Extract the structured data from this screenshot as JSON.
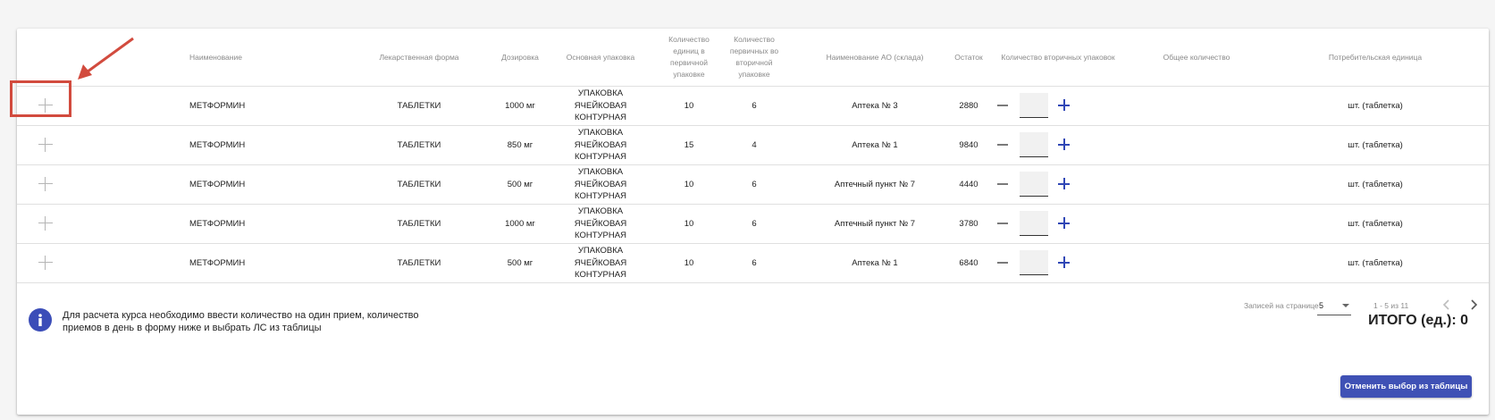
{
  "table": {
    "headers": {
      "name": "Наименование",
      "form": "Лекарственная форма",
      "dosage": "Дозировка",
      "main_pack": "Основная упаковка",
      "units_in_primary": [
        "Количество",
        "единиц в",
        "первичной",
        "упаковке"
      ],
      "primary_in_secondary": [
        "Количество",
        "первичных во",
        "вторичной",
        "упаковке"
      ],
      "warehouse": "Наименование АО (склада)",
      "stock": "Остаток",
      "secondary_qty": "Количество вторичных упаковок",
      "total_qty": "Общее количество",
      "consumer_unit": "Потребительская единица"
    },
    "rows": [
      {
        "name": "МЕТФОРМИН",
        "form": "ТАБЛЕТКИ",
        "dosage": "1000 мг",
        "pack": [
          "УПАКОВКА",
          "ЯЧЕЙКОВАЯ",
          "КОНТУРНАЯ"
        ],
        "units": "10",
        "primary": "6",
        "warehouse": "Аптека № 3",
        "stock": "2880",
        "qty": "",
        "total": "",
        "unit": "шт. (таблетка)"
      },
      {
        "name": "МЕТФОРМИН",
        "form": "ТАБЛЕТКИ",
        "dosage": "850 мг",
        "pack": [
          "УПАКОВКА",
          "ЯЧЕЙКОВАЯ",
          "КОНТУРНАЯ"
        ],
        "units": "15",
        "primary": "4",
        "warehouse": "Аптека № 1",
        "stock": "9840",
        "qty": "",
        "total": "",
        "unit": "шт. (таблетка)"
      },
      {
        "name": "МЕТФОРМИН",
        "form": "ТАБЛЕТКИ",
        "dosage": "500 мг",
        "pack": [
          "УПАКОВКА",
          "ЯЧЕЙКОВАЯ",
          "КОНТУРНАЯ"
        ],
        "units": "10",
        "primary": "6",
        "warehouse": "Аптечный пункт № 7",
        "stock": "4440",
        "qty": "",
        "total": "",
        "unit": "шт. (таблетка)"
      },
      {
        "name": "МЕТФОРМИН",
        "form": "ТАБЛЕТКИ",
        "dosage": "1000 мг",
        "pack": [
          "УПАКОВКА",
          "ЯЧЕЙКОВАЯ",
          "КОНТУРНАЯ"
        ],
        "units": "10",
        "primary": "6",
        "warehouse": "Аптечный пункт № 7",
        "stock": "3780",
        "qty": "",
        "total": "",
        "unit": "шт. (таблетка)"
      },
      {
        "name": "МЕТФОРМИН",
        "form": "ТАБЛЕТКИ",
        "dosage": "500 мг",
        "pack": [
          "УПАКОВКА",
          "ЯЧЕЙКОВАЯ",
          "КОНТУРНАЯ"
        ],
        "units": "10",
        "primary": "6",
        "warehouse": "Аптека № 1",
        "stock": "6840",
        "qty": "",
        "total": "",
        "unit": "шт. (таблетка)"
      }
    ]
  },
  "pagination": {
    "label": "Записей на странице",
    "page_size": "5",
    "range": "1 - 5 из 11"
  },
  "info": {
    "text": "Для расчета курса необходимо ввести количество на один прием, количество приемов в день в форму ниже и выбрать ЛС из таблицы",
    "icon": "i"
  },
  "total": "ИТОГО (ед.): 0",
  "cancel_button": "Отменить выбор из таблицы",
  "colors": {
    "accent": "#3f51b5",
    "annotation": "#d24b3e"
  }
}
